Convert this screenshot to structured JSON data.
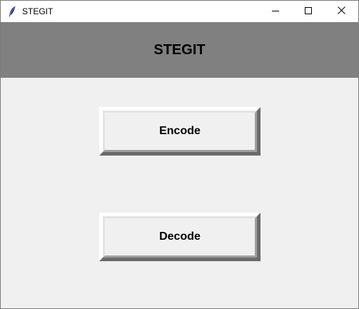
{
  "window": {
    "title": "STEGIT",
    "icon": "feather-icon",
    "controls": [
      "minimize-icon",
      "maximize-icon",
      "close-icon"
    ]
  },
  "header": {
    "title": "STEGIT",
    "background": "#808080"
  },
  "buttons": {
    "encode_label": "Encode",
    "decode_label": "Decode"
  },
  "colors": {
    "window_bg": "#f0f0f0",
    "titlebar_bg": "#ffffff"
  }
}
